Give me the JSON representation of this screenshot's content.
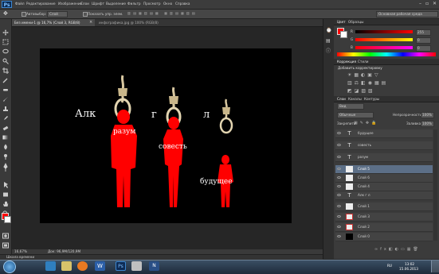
{
  "menu": {
    "logo": "Ps",
    "items": [
      "Файл",
      "Редактирование",
      "Изображение",
      "Слои",
      "Шрифт",
      "Выделение",
      "Фильтр",
      "Просмотр",
      "Окно",
      "Справка"
    ]
  },
  "options": {
    "autoselect_label": "Автовыбор:",
    "autoselect_value": "Слой",
    "show_controls_label": "Показать упр. элем.",
    "workspace": "Основная рабочая среда"
  },
  "document": {
    "tab_active": "Без имени-1 @ 16,7% (Слой 3, RGB/8)",
    "tab_second": "инфографика.jpg @ 100% (RGB/8)",
    "zoom": "16,67%",
    "doc_info": "Док: 96,9М/120,9М",
    "timeline_label": "Шкала времени"
  },
  "canvas_art": {
    "words": [
      "Алк",
      "г",
      "л"
    ],
    "labels": [
      "разум",
      "совесть",
      "будущее"
    ]
  },
  "color_panel": {
    "tabs": [
      "Цвет",
      "Образцы"
    ],
    "channels": [
      {
        "name": "R",
        "value": "255",
        "color": "#ff0000"
      },
      {
        "name": "G",
        "value": "0",
        "color": "#00ff00"
      },
      {
        "name": "B",
        "value": "0",
        "color": "#0000ff"
      }
    ],
    "foreground": "#ff0000",
    "background": "#ffffff"
  },
  "adjustments_panel": {
    "tabs": [
      "Коррекция",
      "Стили"
    ],
    "title": "Добавить корректировку"
  },
  "layers_panel": {
    "tabs": [
      "Слои",
      "Каналы",
      "Контуры"
    ],
    "filter": "Вид",
    "blend_mode": "Обычные",
    "opacity_label": "Непрозрачность:",
    "opacity_value": "100%",
    "lock_label": "Закрепить:",
    "fill_label": "Заливка:",
    "fill_value": "100%",
    "layers": [
      {
        "name": "будущее",
        "type": "text"
      },
      {
        "name": "совесть",
        "type": "text"
      },
      {
        "name": "разум",
        "type": "text"
      },
      {
        "name": "Слой 5",
        "type": "pixel",
        "selected": true
      },
      {
        "name": "Слой 6",
        "type": "pixel"
      },
      {
        "name": "Слой 4",
        "type": "pixel"
      },
      {
        "name": "Алк          г          л",
        "type": "text"
      },
      {
        "name": "Слой 1",
        "type": "pixel"
      },
      {
        "name": "Слой 3",
        "type": "pixel"
      },
      {
        "name": "Слой 2",
        "type": "pixel"
      },
      {
        "name": "Слой 0",
        "type": "black"
      }
    ]
  },
  "taskbar": {
    "time": "13:02",
    "date": "15.06.2013",
    "lang": "RU"
  }
}
